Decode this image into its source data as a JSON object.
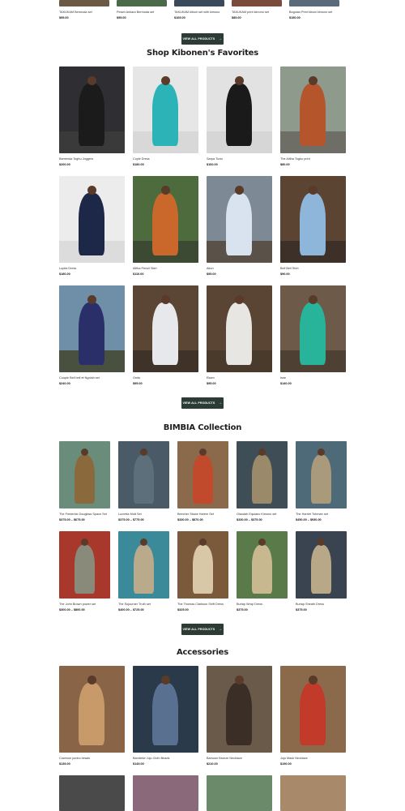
{
  "top_row": {
    "items": [
      {
        "name": "TAKUKAM Bermuda set",
        "price": "$95.00"
      },
      {
        "name": "Peach Ankara Bermuda set",
        "price": "$95.00"
      },
      {
        "name": "TAKUKAM kiboni set with kimono",
        "price": "$165.00"
      },
      {
        "name": "TAKUKAM print kimono set",
        "price": "$85.00"
      },
      {
        "name": "Bogolan Print kiboni kimono set",
        "price": "$150.00"
      }
    ]
  },
  "view_all_label": "VIEW ALL PRODUCTS",
  "favorites": {
    "title": "Shop Kibonen's Favorites",
    "items": [
      {
        "name": "Bamenda Toghu Joggers",
        "price": "$200.00",
        "bg": "#2f2f33",
        "fig": "#1b1b1b",
        "ground": "#3a3a3a"
      },
      {
        "name": "Coyle Dress",
        "price": "$180.00",
        "bg": "#e6e6e6",
        "fig": "#2bb3b8",
        "ground": "#d8d8d8"
      },
      {
        "name": "Sarpa Tunic",
        "price": "$160.00",
        "bg": "#e2e2e2",
        "fig": "#1a1a1a",
        "ground": "#d6d6d6"
      },
      {
        "name": "The Alitha Toghu print",
        "price": "$80.00",
        "bg": "#8e9a8c",
        "fig": "#b5552c",
        "ground": "#6e6e66"
      },
      {
        "name": "Lupita Dress",
        "price": "$180.00",
        "bg": "#ececec",
        "fig": "#1d2748",
        "ground": "#dcdcdc"
      },
      {
        "name": "Alitha Pencil Skirt",
        "price": "$110.00",
        "bg": "#4d6b3c",
        "fig": "#c9682a",
        "ground": "#3c4a33"
      },
      {
        "name": "Akun",
        "price": "$95.00",
        "bg": "#7d8a95",
        "fig": "#d9e3ef",
        "ground": "#5a5148"
      },
      {
        "name": "Bell Bell Shirt",
        "price": "$90.00",
        "bg": "#5c4433",
        "fig": "#8eb5da",
        "ground": "#3d3028"
      },
      {
        "name": "Couple Bell bell et Ngolah set",
        "price": "$240.00",
        "bg": "#6f8fa8",
        "fig": "#2a2f6a",
        "ground": "#4a5040"
      },
      {
        "name": "Ondo",
        "price": "$95.00",
        "bg": "#5b4636",
        "fig": "#e6e8ec",
        "ground": "#3f3229"
      },
      {
        "name": "Ekam",
        "price": "$95.00",
        "bg": "#5a4535",
        "fig": "#e8e6e2",
        "ground": "#4a3a2c"
      },
      {
        "name": "Isse",
        "price": "$140.00",
        "bg": "#6e5a48",
        "fig": "#27b49a",
        "ground": "#4f4034"
      }
    ]
  },
  "bimbia": {
    "title": "BIMBIA Collection",
    "items": [
      {
        "name": "The Frederick Douglass Space Set",
        "price": "$375.00 – $675.00",
        "bg": "#6a8c7a",
        "fig": "#8a6a3c"
      },
      {
        "name": "Lucretia Mott Set",
        "price": "$375.00 – $775.00",
        "bg": "#4a5a66",
        "fig": "#5d6f7a"
      },
      {
        "name": "Beecher Stowe Harem Set",
        "price": "$330.00 – $870.00",
        "bg": "#8a6a4a",
        "fig": "#c24a2c"
      },
      {
        "name": "Olaudah Equiano Kimono set",
        "price": "$330.00 – $375.00",
        "bg": "#3f4e56",
        "fig": "#9a8a6a"
      },
      {
        "name": "The Harriet Tubman set",
        "price": "$450.00 – $930.00",
        "bg": "#4e6a78",
        "fig": "#a89a7a"
      },
      {
        "name": "The John Brown power set",
        "price": "$300.00 – $800.00",
        "bg": "#a8382c",
        "fig": "#8a8a7a"
      },
      {
        "name": "The Sojourner Truth set",
        "price": "$400.00 – $725.00",
        "bg": "#3a8a9a",
        "fig": "#b8aa8a"
      },
      {
        "name": "The Thomas Clarkson Shift Dress",
        "price": "$325.00",
        "bg": "#7a5a3a",
        "fig": "#d8c8a8"
      },
      {
        "name": "Burlap Wrap Dress",
        "price": "$375.00",
        "bg": "#5a7a4a",
        "fig": "#c8b890"
      },
      {
        "name": "Burlap Sheath Dress",
        "price": "$375.00",
        "bg": "#3a4450",
        "fig": "#b8a888"
      }
    ]
  },
  "accessories": {
    "title": "Accessories",
    "items": [
      {
        "name": "Cowhorn jumbo beads",
        "price": "$135.00",
        "bg": "#8a6446",
        "fig": "#c89a6a"
      },
      {
        "name": "Bamileke Juju Cloth Beads",
        "price": "$145.00",
        "bg": "#2a3a4a",
        "fig": "#5a7090"
      },
      {
        "name": "Bamoun Bronze Necklace",
        "price": "$210.00",
        "bg": "#6a5a4a",
        "fig": "#3a2e26"
      },
      {
        "name": "Juju Mask Necklace",
        "price": "$190.00",
        "bg": "#8a6a4a",
        "fig": "#c23a2a"
      }
    ],
    "partial_row": [
      {
        "bg": "#4a4a4a"
      },
      {
        "bg": "#8a6a7a"
      },
      {
        "bg": "#6a8a6a"
      },
      {
        "bg": "#a88a6a"
      }
    ]
  }
}
